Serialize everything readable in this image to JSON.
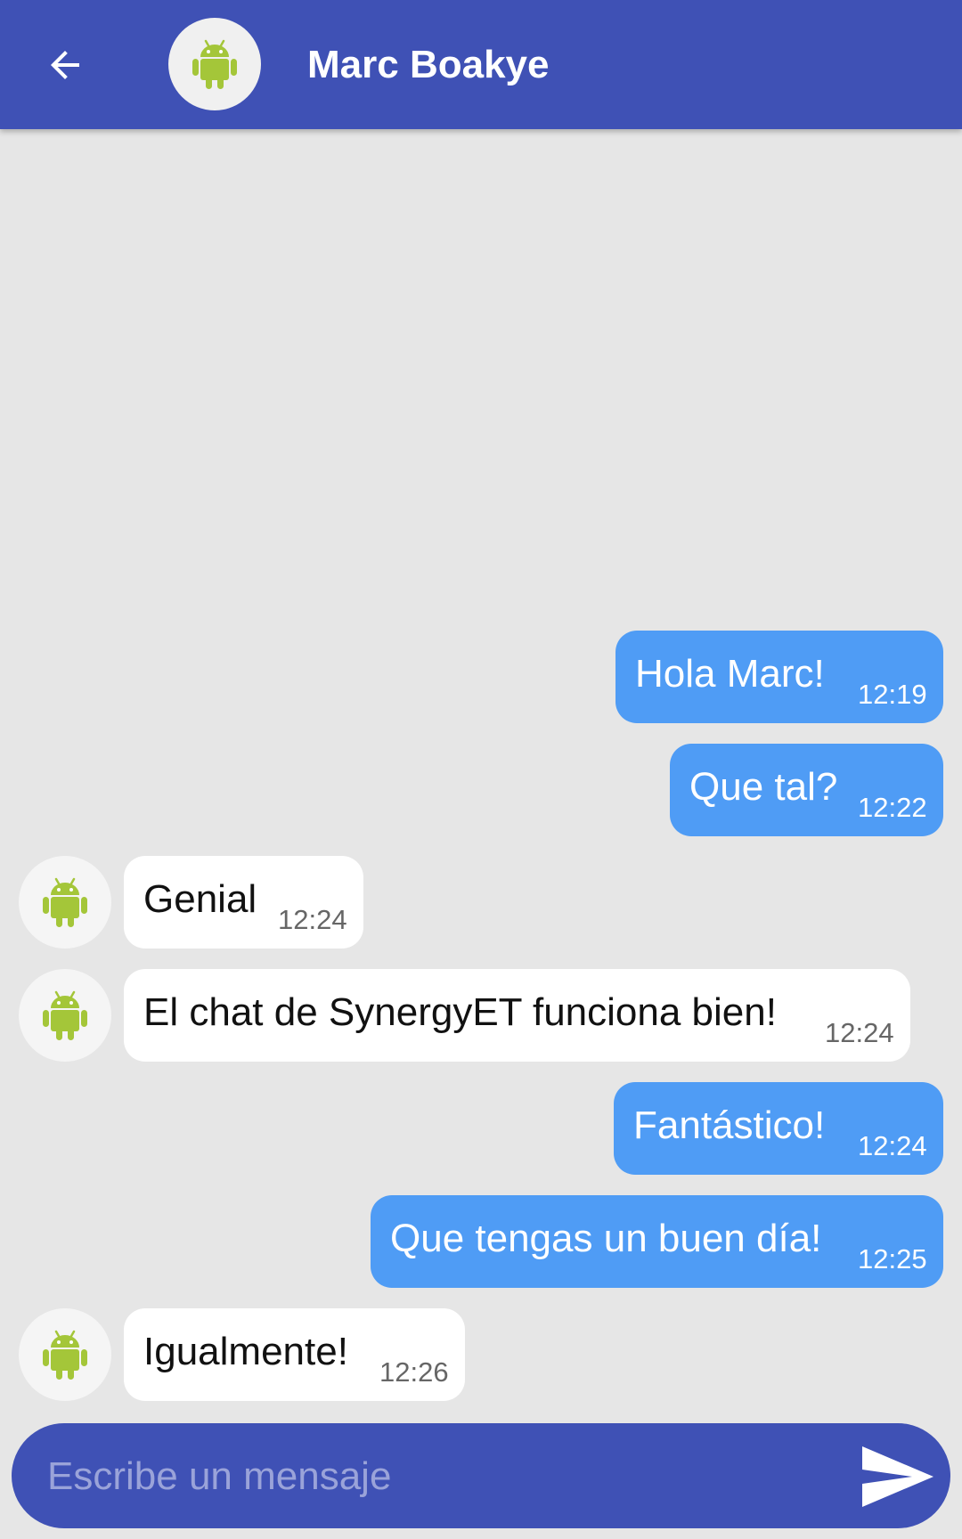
{
  "header": {
    "back_icon": "arrow-back-icon",
    "avatar_icon": "android-robot-icon",
    "contact_name": "Marc Boakye",
    "bar_color": "#3f51b5"
  },
  "messages": [
    {
      "direction": "outgoing",
      "text": "Hola Marc!",
      "time": "12:19"
    },
    {
      "direction": "outgoing",
      "text": "Que tal?",
      "time": "12:22"
    },
    {
      "direction": "incoming",
      "text": "Genial",
      "time": "12:24"
    },
    {
      "direction": "incoming",
      "text": "El chat de SynergyET funciona bien!",
      "time": "12:24"
    },
    {
      "direction": "outgoing",
      "text": "Fantástico!",
      "time": "12:24"
    },
    {
      "direction": "outgoing",
      "text": "Que tengas un buen día!",
      "time": "12:25"
    },
    {
      "direction": "incoming",
      "text": "Igualmente!",
      "time": "12:26"
    }
  ],
  "composer": {
    "placeholder": "Escribe un mensaje",
    "value": "",
    "send_icon": "send-icon"
  },
  "colors": {
    "outgoing_bubble": "#4f9cf5",
    "incoming_bubble": "#ffffff",
    "background": "#e6e6e6",
    "android_green": "#a4c639"
  }
}
